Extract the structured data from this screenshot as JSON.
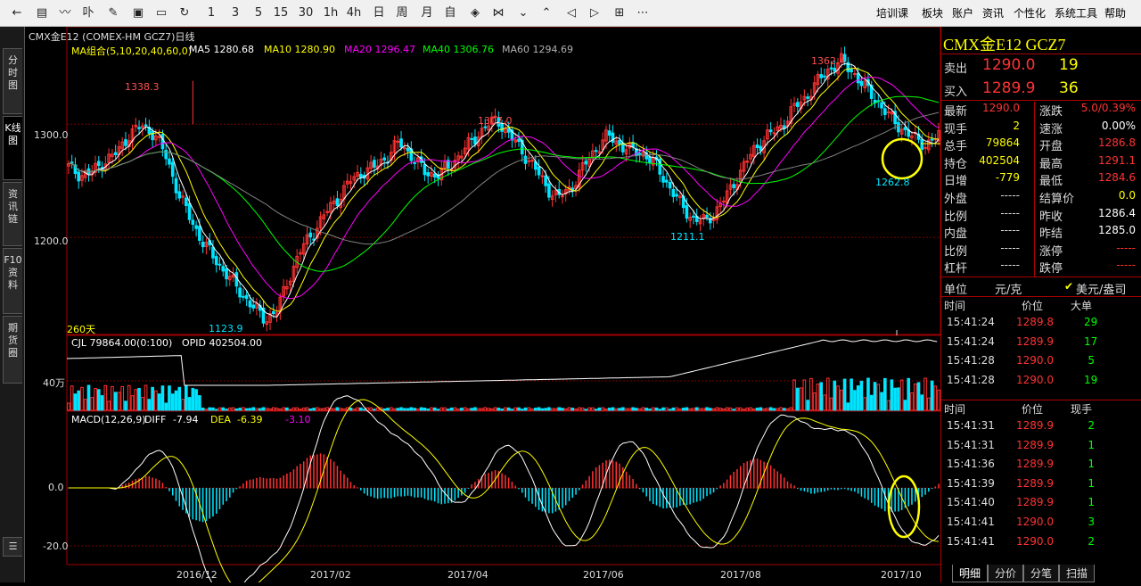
{
  "toolbar": {
    "icons": [
      "back-arrow-icon",
      "grid-icon",
      "line-chart-icon",
      "candlestick-icon",
      "draw-icon",
      "chart-window-icon",
      "save-icon",
      "refresh-icon"
    ],
    "periods": [
      "1",
      "3",
      "5",
      "15",
      "30",
      "1h",
      "4h",
      "日",
      "周",
      "月",
      "自"
    ],
    "tools": [
      "eye-icon",
      "collapse-icon",
      "chevron-down-icon",
      "chevron-up-icon",
      "left-icon",
      "right-icon",
      "layout-icon",
      "more-icon"
    ],
    "menu": [
      "培训课",
      "板块",
      "账户",
      "资讯",
      "个性化",
      "系统工具",
      "帮助"
    ]
  },
  "side_tabs": [
    "分时图",
    "K线图",
    "资讯链",
    "F10资料",
    "期货圈"
  ],
  "chart": {
    "symbol_line": "CMX金E12 (COMEX-HM GCZ7)日线",
    "ma": {
      "label": "MA组合(5,10,20,40,60,0)",
      "ma5": "MA5 1280.68",
      "ma10": "MA10 1280.90",
      "ma20": "MA20 1296.47",
      "ma40": "MA40 1306.76",
      "ma60": "MA60 1294.69"
    },
    "price_axis": [
      "1300.0",
      "1200.0"
    ],
    "annotations": [
      "1338.3",
      "1307.0",
      "1362.4",
      "1123.9",
      "1211.1",
      "1262.8"
    ],
    "days_label": "260天",
    "vol": {
      "cjl": "CJL 79864.00(0:100)",
      "opid": "OPID 402504.00",
      "axis": "40万"
    },
    "macd": {
      "label": "MACD(12,26,9)",
      "diff_label": "DIFF",
      "diff_value": "-7.94",
      "dea_label": "DEA",
      "dea_value": "-6.39",
      "macd_value": "-3.10",
      "axis": [
        "0.0",
        "-20.0"
      ]
    },
    "dates": [
      "2016/12",
      "2017/02",
      "2017/04",
      "2017/06",
      "2017/08",
      "2017/10"
    ],
    "colors": {
      "up": "#ff3232",
      "down": "#00e5ff",
      "ma5": "#ffffff",
      "ma10": "#ffff00",
      "ma20": "#ff00ff",
      "ma40": "#00ff00",
      "ma60": "#808080",
      "border": "#a00000"
    }
  },
  "chart_data": {
    "type": "candlestick",
    "title": "CMX金E12 (COMEX-HM GCZ7)日线",
    "ylim": [
      1115,
      1375
    ],
    "x": [
      "2016/12",
      "2017/02",
      "2017/04",
      "2017/06",
      "2017/08",
      "2017/10"
    ],
    "close_path": [
      1262,
      1255,
      1258,
      1268,
      1275,
      1292,
      1298,
      1292,
      1270,
      1238,
      1215,
      1195,
      1180,
      1166,
      1152,
      1139,
      1128,
      1135,
      1165,
      1190,
      1205,
      1222,
      1235,
      1250,
      1258,
      1262,
      1272,
      1284,
      1272,
      1258,
      1255,
      1262,
      1274,
      1286,
      1298,
      1304,
      1290,
      1276,
      1262,
      1244,
      1235,
      1244,
      1262,
      1278,
      1290,
      1282,
      1276,
      1274,
      1262,
      1245,
      1228,
      1216,
      1214,
      1226,
      1242,
      1262,
      1278,
      1290,
      1296,
      1312,
      1322,
      1336,
      1348,
      1356,
      1346,
      1332,
      1320,
      1306,
      1296,
      1287,
      1282,
      1290
    ],
    "volume_hint": "high volume in Dec and Sep-Oct",
    "macd_hint": "DIFF -7.94 DEA -6.39 MACD -3.10"
  },
  "quote": {
    "title": "CMX金E12  GCZ7",
    "sell_label": "卖出",
    "sell_price": "1290.0",
    "sell_vol": "19",
    "buy_label": "买入",
    "buy_price": "1289.9",
    "buy_vol": "36",
    "rows": [
      [
        "最新",
        "1290.0",
        "涨跌",
        "5.0/0.39%"
      ],
      [
        "现手",
        "2",
        "速涨",
        "0.00%"
      ],
      [
        "总手",
        "79864",
        "开盘",
        "1286.8"
      ],
      [
        "持仓",
        "402504",
        "最高",
        "1291.1"
      ],
      [
        "日增",
        "-779",
        "最低",
        "1284.6"
      ],
      [
        "外盘",
        "-----",
        "结算价",
        "0.0"
      ],
      [
        "比例",
        "-----",
        "昨收",
        "1286.4"
      ],
      [
        "内盘",
        "-----",
        "昨结",
        "1285.0"
      ],
      [
        "比例",
        "-----",
        "涨停",
        "-----"
      ],
      [
        "杠杆",
        "-----",
        "跌停",
        "-----"
      ]
    ],
    "unit_label": "单位",
    "unit_value": "元/克",
    "unit_check": "美元/盎司",
    "t1_headers": [
      "时间",
      "价位",
      "大单"
    ],
    "t1": [
      [
        "15:41:24",
        "1289.8",
        "29"
      ],
      [
        "15:41:24",
        "1289.9",
        "17"
      ],
      [
        "15:41:28",
        "1290.0",
        "5"
      ],
      [
        "15:41:28",
        "1290.0",
        "19"
      ]
    ],
    "t2_headers": [
      "时间",
      "价位",
      "现手"
    ],
    "t2": [
      [
        "15:41:31",
        "1289.9",
        "2"
      ],
      [
        "15:41:31",
        "1289.9",
        "1"
      ],
      [
        "15:41:36",
        "1289.9",
        "1"
      ],
      [
        "15:41:39",
        "1289.9",
        "1"
      ],
      [
        "15:41:40",
        "1289.9",
        "1"
      ],
      [
        "15:41:41",
        "1290.0",
        "3"
      ],
      [
        "15:41:41",
        "1290.0",
        "2"
      ]
    ]
  },
  "bottom_tabs": [
    "明细",
    "分价",
    "分笔",
    "扫描"
  ]
}
